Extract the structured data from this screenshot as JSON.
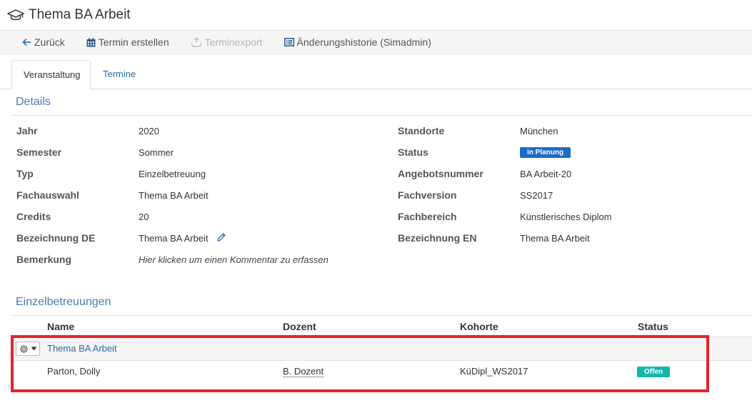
{
  "header": {
    "title": "Thema BA Arbeit",
    "icon": "graduation-cap-icon"
  },
  "toolbar": {
    "back_label": "Zurück",
    "create_event_label": "Termin erstellen",
    "export_label": "Terminexport",
    "history_label": "Änderungshistorie (Simadmin)"
  },
  "tabs": [
    {
      "label": "Veranstaltung",
      "active": true
    },
    {
      "label": "Termine",
      "active": false
    }
  ],
  "details": {
    "title": "Details",
    "left": [
      {
        "label": "Jahr",
        "value": "2020"
      },
      {
        "label": "Semester",
        "value": "Sommer"
      },
      {
        "label": "Typ",
        "value": "Einzelbetreuung"
      },
      {
        "label": "Fachauswahl",
        "value": "Thema BA Arbeit"
      },
      {
        "label": "Credits",
        "value": "20"
      },
      {
        "label": "Bezeichnung DE",
        "value": "Thema BA Arbeit"
      },
      {
        "label": "Bemerkung",
        "value": "Hier klicken um einen Kommentar zu erfassen"
      }
    ],
    "right": [
      {
        "label": "Standorte",
        "value": "München"
      },
      {
        "label": "Status",
        "value": "in Planung"
      },
      {
        "label": "Angebotsnummer",
        "value": "BA Arbeit-20"
      },
      {
        "label": "Fachversion",
        "value": "SS2017"
      },
      {
        "label": "Fachbereich",
        "value": "Künstlerisches Diplom"
      },
      {
        "label": "Bezeichnung EN",
        "value": "Thema BA Arbeit"
      }
    ]
  },
  "einzel": {
    "title": "Einzelbetreuungen",
    "columns": [
      "Name",
      "Dozent",
      "Kohorte",
      "Status"
    ],
    "group": "Thema BA Arbeit",
    "row": {
      "name": "Parton, Dolly",
      "dozent": "B. Dozent",
      "kohorte": "KüDipl_WS2017",
      "status": "Offen"
    }
  },
  "colors": {
    "link": "#2b6aa8",
    "status_planning": "#1d6bc7",
    "status_open": "#16b6a8",
    "highlight": "#e3242b"
  }
}
